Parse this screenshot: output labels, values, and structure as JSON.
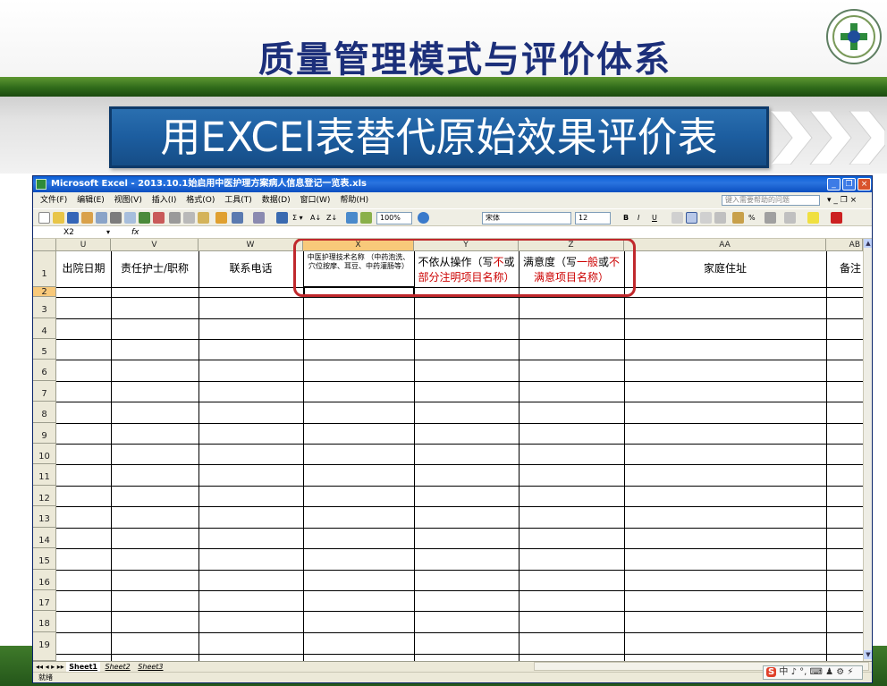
{
  "slide": {
    "title": "质量管理模式与评价体系",
    "subtitle": "用EXCEl表替代原始效果评价表",
    "logo_icon": "hospital-emblem-icon"
  },
  "excel": {
    "window_title": "Microsoft Excel - 2013.10.1始启用中医护理方案病人信息登记一览表.xls",
    "menu": [
      "文件(F)",
      "编辑(E)",
      "视图(V)",
      "插入(I)",
      "格式(O)",
      "工具(T)",
      "数据(D)",
      "窗口(W)",
      "帮助(H)"
    ],
    "help_placeholder": "键入需要帮助的问题",
    "toolbar": {
      "zoom": "100%",
      "font": "宋体",
      "font_size": "12",
      "bold": "B",
      "italic": "I",
      "underline": "U",
      "percent": "%"
    },
    "name_box": "X2",
    "fx_label": "fx",
    "columns": [
      "U",
      "V",
      "W",
      "X",
      "Y",
      "Z",
      "AA",
      "AB"
    ],
    "selected_column": "X",
    "header_row": {
      "U": "出院日期",
      "V": "责任护士/职称",
      "W": "联系电话",
      "X": "中医护理技术名称 （中药泡洗、穴位按摩、耳豆、中药灌肠等）",
      "Y_line1_a": "不依从操作（写",
      "Y_line1_b": "不",
      "Y_line1_c": "或",
      "Y_line2": "部分注明项目名称）",
      "Z_line1_a": "满意度（写",
      "Z_line1_b": "一般",
      "Z_line1_c": "或",
      "Z_line1_d": "不",
      "Z_line2": "满意项目名称）",
      "AA": "家庭住址",
      "AB": "备注"
    },
    "row_numbers": [
      "1",
      "2",
      "3",
      "4",
      "5",
      "6",
      "7",
      "8",
      "9",
      "10",
      "11",
      "12",
      "13",
      "14",
      "15",
      "16",
      "17",
      "18",
      "19"
    ],
    "selected_row": "2",
    "sheets": [
      "Sheet1",
      "Sheet2",
      "Sheet3"
    ],
    "active_sheet": "Sheet1",
    "status": "就绪",
    "highlight_color": "#c0282c"
  },
  "ime": {
    "logo": "S",
    "text": "中 ♪ °, ⌨ ♟ ⚙ ⚡"
  }
}
